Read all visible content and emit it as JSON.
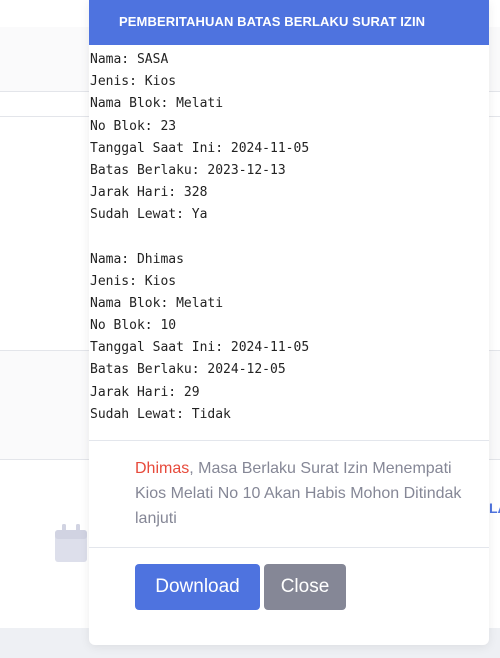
{
  "modal": {
    "title": "PEMBERITAHUAN BATAS BERLAKU SURAT IZIN",
    "records": [
      {
        "lines": [
          "Nama: SASA",
          "Jenis: Kios",
          "Nama Blok: Melati",
          "No Blok: 23",
          "Tanggal Saat Ini: 2024-11-05",
          "Batas Berlaku: 2023-12-13",
          "Jarak Hari: 328",
          "Sudah Lewat: Ya"
        ]
      },
      {
        "lines": [
          "Nama: Dhimas",
          "Jenis: Kios",
          "Nama Blok: Melati",
          "No Blok: 10",
          "Tanggal Saat Ini: 2024-11-05",
          "Batas Berlaku: 2024-12-05",
          "Jarak Hari: 29",
          "Sudah Lewat: Tidak"
        ]
      }
    ],
    "notice": {
      "name": "Dhimas",
      "message": ", Masa Berlaku Surat Izin Menempati Kios Melati No 10 Akan Habis Mohon Ditindak lanjuti"
    },
    "buttons": {
      "download": "Download",
      "close": "Close"
    }
  },
  "background": {
    "cutoff_text": "LA",
    "icon": "calendar-icon"
  },
  "colors": {
    "primary": "#4e73df",
    "secondary": "#858796",
    "danger": "#e74a3b"
  }
}
